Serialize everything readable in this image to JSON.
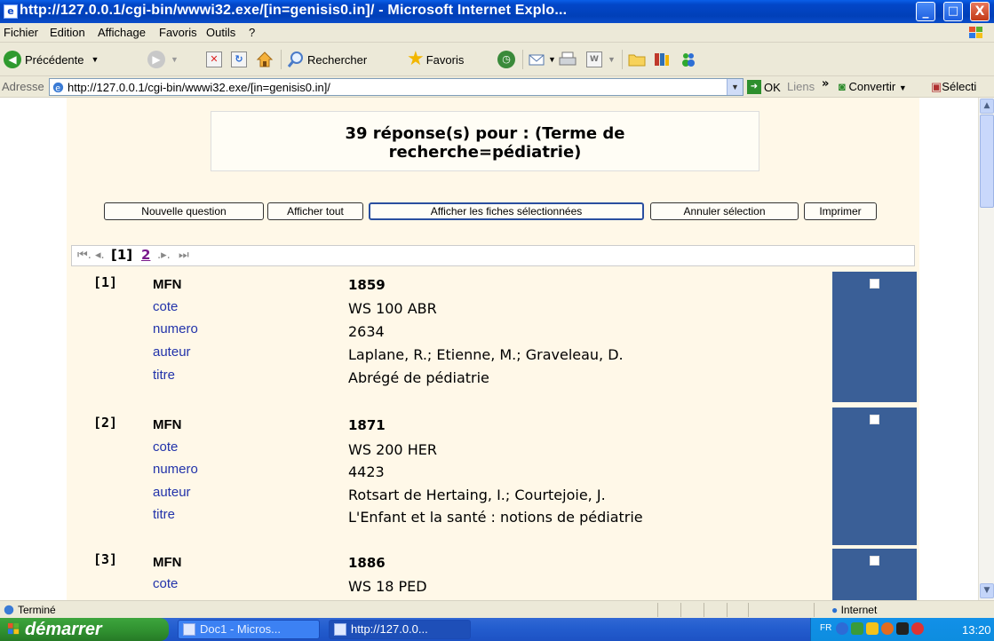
{
  "window": {
    "title": "http://127.0.0.1/cgi-bin/wwwi32.exe/[in=genisis0.in]/ - Microsoft Internet Explo...",
    "min": "_",
    "max": "□",
    "close": "X"
  },
  "menu": [
    "Fichier",
    "Edition",
    "Affichage",
    "Favoris",
    "Outils",
    "?"
  ],
  "toolbar": {
    "back": "Précédente",
    "search": "Rechercher",
    "favorites": "Favoris"
  },
  "address": {
    "label": "Adresse",
    "url": "http://127.0.0.1/cgi-bin/wwwi32.exe/[in=genisis0.in]/",
    "go": "OK",
    "links": "Liens",
    "chevron": "»",
    "convert": "Convertir",
    "select": "Sélecti"
  },
  "results": {
    "header_line1": "39 réponse(s) pour : (Terme de",
    "header_line2": "recherche=pédiatrie)"
  },
  "buttons": {
    "new_question": "Nouvelle question",
    "show_all": "Afficher tout",
    "show_selected": "Afficher les fiches sélectionnées",
    "cancel_selection": "Annuler sélection",
    "print": "Imprimer"
  },
  "pager": {
    "first": "⏮.",
    "prev": "◂.",
    "current": "[1]",
    "page2": "2",
    "next": ".▸.",
    "last": "⏭"
  },
  "records": [
    {
      "num": "[1]",
      "fields": [
        {
          "label": "MFN",
          "value": "1859"
        },
        {
          "label": "cote",
          "value": "WS 100 ABR"
        },
        {
          "label": "numero",
          "value": "2634"
        },
        {
          "label": "auteur",
          "value": "Laplane, R.; Etienne, M.; Graveleau, D."
        },
        {
          "label": "titre",
          "value": "Abrégé de pédiatrie"
        }
      ]
    },
    {
      "num": "[2]",
      "fields": [
        {
          "label": "MFN",
          "value": "1871"
        },
        {
          "label": "cote",
          "value": "WS 200 HER"
        },
        {
          "label": "numero",
          "value": "4423"
        },
        {
          "label": "auteur",
          "value": "Rotsart de Hertaing, I.; Courtejoie, J."
        },
        {
          "label": "titre",
          "value": "L'Enfant et la santé : notions de pédiatrie"
        }
      ]
    },
    {
      "num": "[3]",
      "fields": [
        {
          "label": "MFN",
          "value": "1886"
        },
        {
          "label": "cote",
          "value": "WS 18 PED"
        }
      ]
    }
  ],
  "status": {
    "text": "Terminé",
    "zone": "Internet"
  },
  "taskbar": {
    "start": "démarrer",
    "task1": "Doc1 - Micros...",
    "task2": "http://127.0.0...",
    "lang": "FR",
    "clock": "13:20"
  }
}
